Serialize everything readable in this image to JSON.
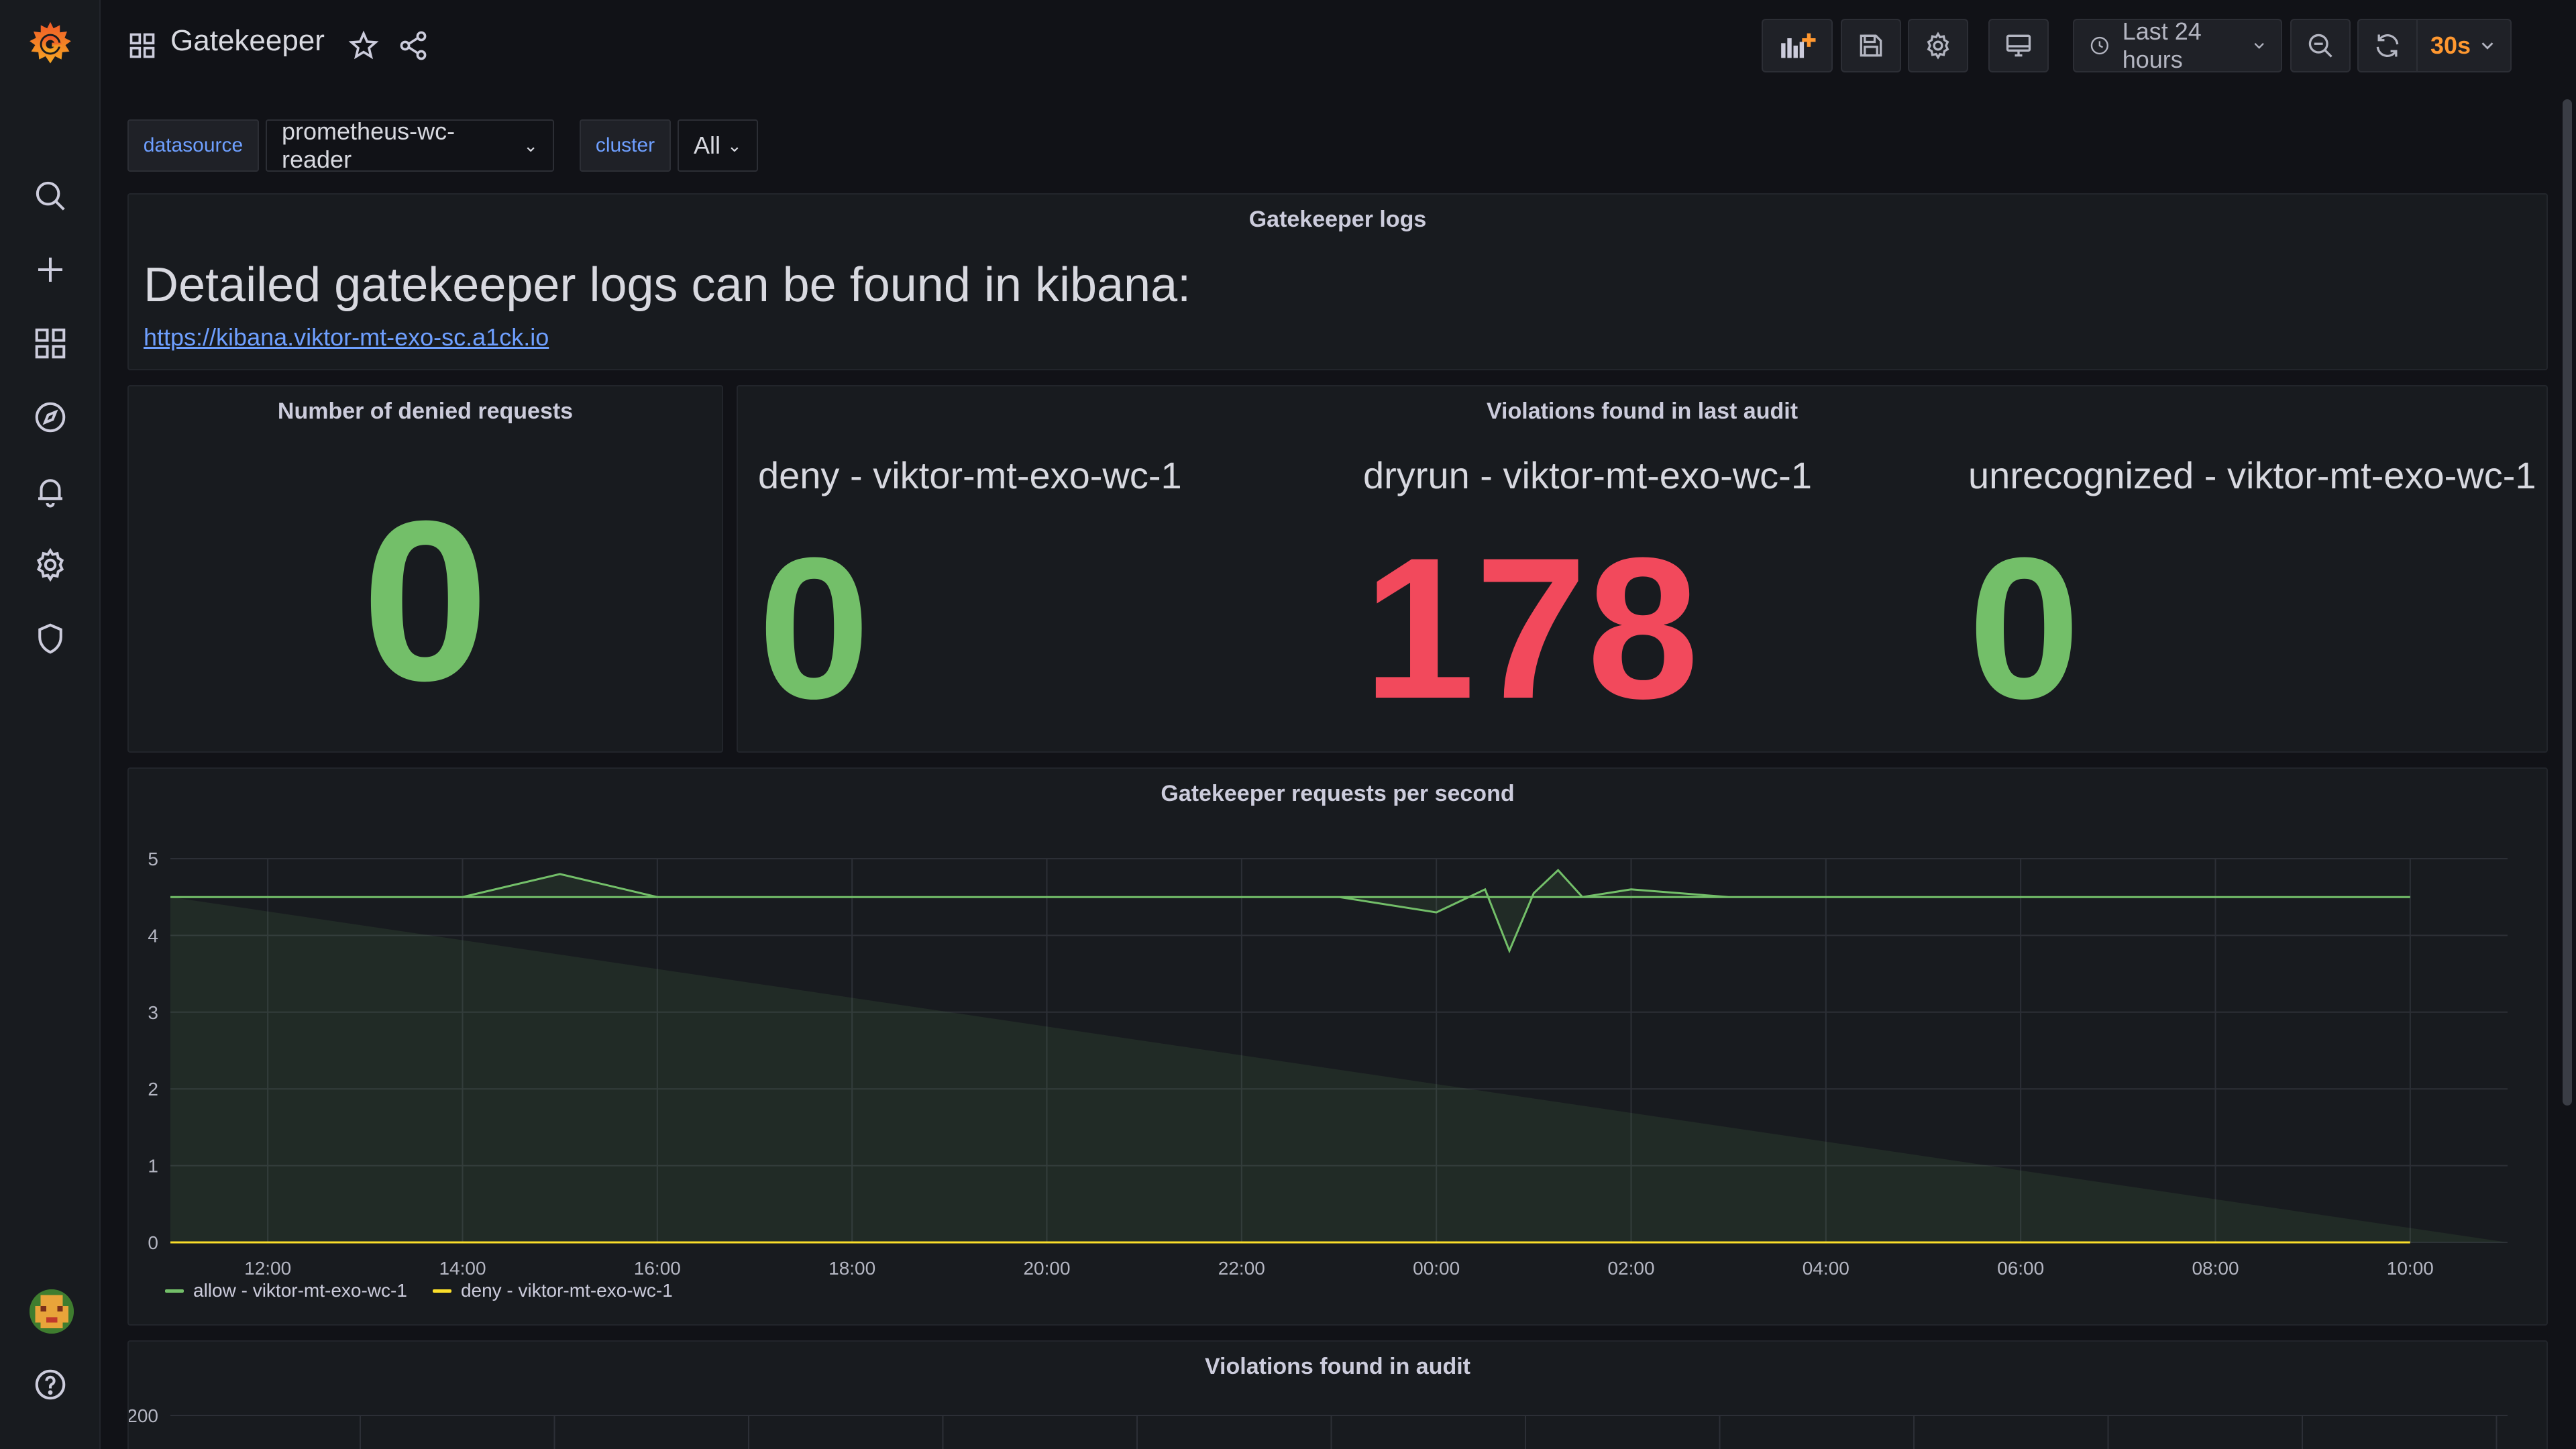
{
  "app": {
    "dashboard_title": "Gatekeeper",
    "colors": {
      "green": "#73bf69",
      "red": "#f2495c",
      "yellow": "#fade2a",
      "link": "#6e9fff",
      "orange": "#ff9830"
    }
  },
  "sidebar": {
    "logo": "grafana-logo-icon",
    "items": [
      {
        "icon": "search-icon"
      },
      {
        "icon": "plus-icon"
      },
      {
        "icon": "dashboards-icon"
      },
      {
        "icon": "explore-compass-icon"
      },
      {
        "icon": "alerting-bell-icon"
      },
      {
        "icon": "configuration-gear-icon"
      },
      {
        "icon": "shield-icon"
      }
    ],
    "bottom": [
      {
        "icon": "avatar"
      },
      {
        "icon": "help-icon"
      }
    ]
  },
  "toolbar": {
    "time_range": "Last 24 hours",
    "refresh_interval": "30s"
  },
  "variables": [
    {
      "label": "datasource",
      "value": "prometheus-wc-reader"
    },
    {
      "label": "cluster",
      "value": "All"
    }
  ],
  "panels": {
    "logs": {
      "title": "Gatekeeper logs",
      "heading": "Detailed gatekeeper logs can be found in kibana:",
      "link": "https://kibana.viktor-mt-exo-sc.a1ck.io"
    },
    "denied": {
      "title": "Number of denied requests",
      "value": "0"
    },
    "violations": {
      "title": "Violations found in last audit",
      "stats": [
        {
          "label": "deny - viktor-mt-exo-wc-1",
          "value": "0",
          "color": "#73bf69"
        },
        {
          "label": "dryrun - viktor-mt-exo-wc-1",
          "value": "178",
          "color": "#f2495c"
        },
        {
          "label": "unrecognized - viktor-mt-exo-wc-1",
          "value": "0",
          "color": "#73bf69"
        }
      ]
    },
    "rps": {
      "title": "Gatekeeper requests per second"
    },
    "audit": {
      "title": "Violations found in audit"
    }
  },
  "chart_data": [
    {
      "type": "line",
      "title": "Gatekeeper requests per second",
      "x": [
        "11:00",
        "12:00",
        "13:00",
        "14:00",
        "15:00",
        "16:00",
        "17:00",
        "18:00",
        "19:00",
        "20:00",
        "21:00",
        "22:00",
        "23:00",
        "00:00",
        "00:30",
        "00:45",
        "01:00",
        "01:15",
        "01:30",
        "02:00",
        "03:00",
        "04:00",
        "05:00",
        "06:00",
        "07:00",
        "08:00",
        "09:00",
        "10:00",
        "11:00"
      ],
      "x_ticks": [
        "12:00",
        "14:00",
        "16:00",
        "18:00",
        "20:00",
        "22:00",
        "00:00",
        "02:00",
        "04:00",
        "06:00",
        "08:00",
        "10:00"
      ],
      "series": [
        {
          "name": "allow - viktor-mt-exo-wc-1",
          "color": "#73bf69",
          "values": [
            4.5,
            4.5,
            4.5,
            4.5,
            4.8,
            4.5,
            4.5,
            4.5,
            4.5,
            4.5,
            4.5,
            4.5,
            4.5,
            4.3,
            4.6,
            3.8,
            4.55,
            4.85,
            4.5,
            4.6,
            4.5,
            4.5,
            4.5,
            4.5,
            4.5,
            4.5,
            4.5,
            4.5,
            4.5
          ]
        },
        {
          "name": "deny - viktor-mt-exo-wc-1",
          "color": "#fade2a",
          "values": [
            0,
            0,
            0,
            0,
            0,
            0,
            0,
            0,
            0,
            0,
            0,
            0,
            0,
            0,
            0,
            0,
            0,
            0,
            0,
            0,
            0,
            0,
            0,
            0,
            0,
            0,
            0,
            0,
            0
          ]
        }
      ],
      "ylim": [
        0,
        5
      ],
      "y_ticks": [
        0,
        1,
        2,
        3,
        4,
        5
      ],
      "grid": true,
      "legend": "bottom-left"
    },
    {
      "type": "line",
      "title": "Violations found in audit",
      "y_ticks": [
        200
      ],
      "grid": true
    }
  ]
}
